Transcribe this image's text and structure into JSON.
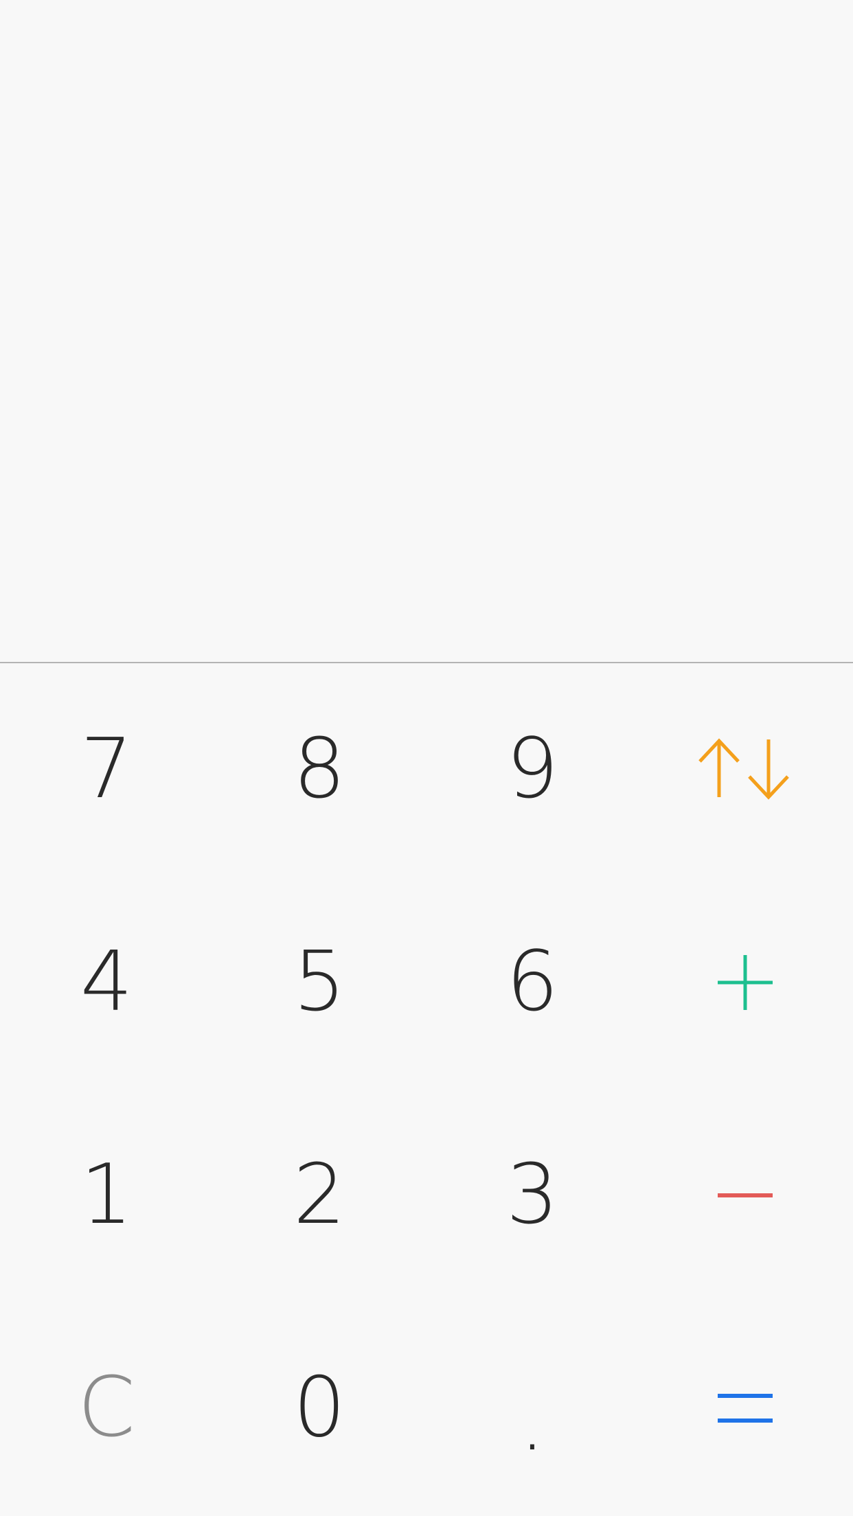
{
  "display": {
    "value": ""
  },
  "keypad": {
    "digits": {
      "seven": "7",
      "eight": "8",
      "nine": "9",
      "four": "4",
      "five": "5",
      "six": "6",
      "one": "1",
      "two": "2",
      "three": "3",
      "zero": "0",
      "decimal": "."
    },
    "clear_label": "C",
    "icons": {
      "swap": "swap-arrows-icon",
      "plus": "plus-icon",
      "minus": "minus-icon",
      "equals": "equals-icon"
    }
  },
  "colors": {
    "background": "#f8f8f8",
    "digit": "#2a2a2a",
    "clear": "#8c8c8c",
    "divider": "#b4b4b4",
    "swap": "#f4a01c",
    "plus": "#1dbf8f",
    "minus": "#e35b58",
    "equals": "#1f73e8"
  }
}
